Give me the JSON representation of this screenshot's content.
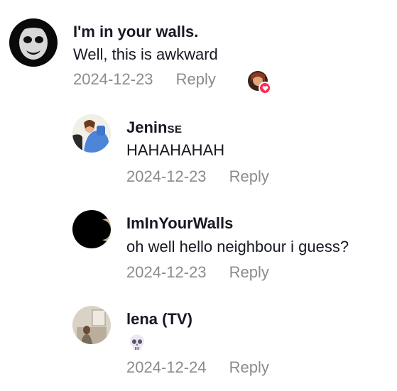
{
  "comments": [
    {
      "username": "I'm in your walls.",
      "text": "Well, this is awkward",
      "date": "2024-12-23",
      "reply": "Reply"
    },
    {
      "username_main": "Jenin",
      "username_suffix": "SE",
      "text": "HAHAHAHAH",
      "date": "2024-12-23",
      "reply": "Reply"
    },
    {
      "username": "ImInYourWalls",
      "text": "oh well hello neighbour i guess?",
      "date": "2024-12-23",
      "reply": "Reply"
    },
    {
      "username": "lena (TV)",
      "emoji": "skull-emoji",
      "date": "2024-12-24",
      "reply": "Reply"
    }
  ],
  "colors": {
    "text": "#161823",
    "meta": "#8a8b91",
    "heart_badge": "#fe2c55"
  },
  "icons": [
    "heart-icon",
    "skull-emoji"
  ]
}
